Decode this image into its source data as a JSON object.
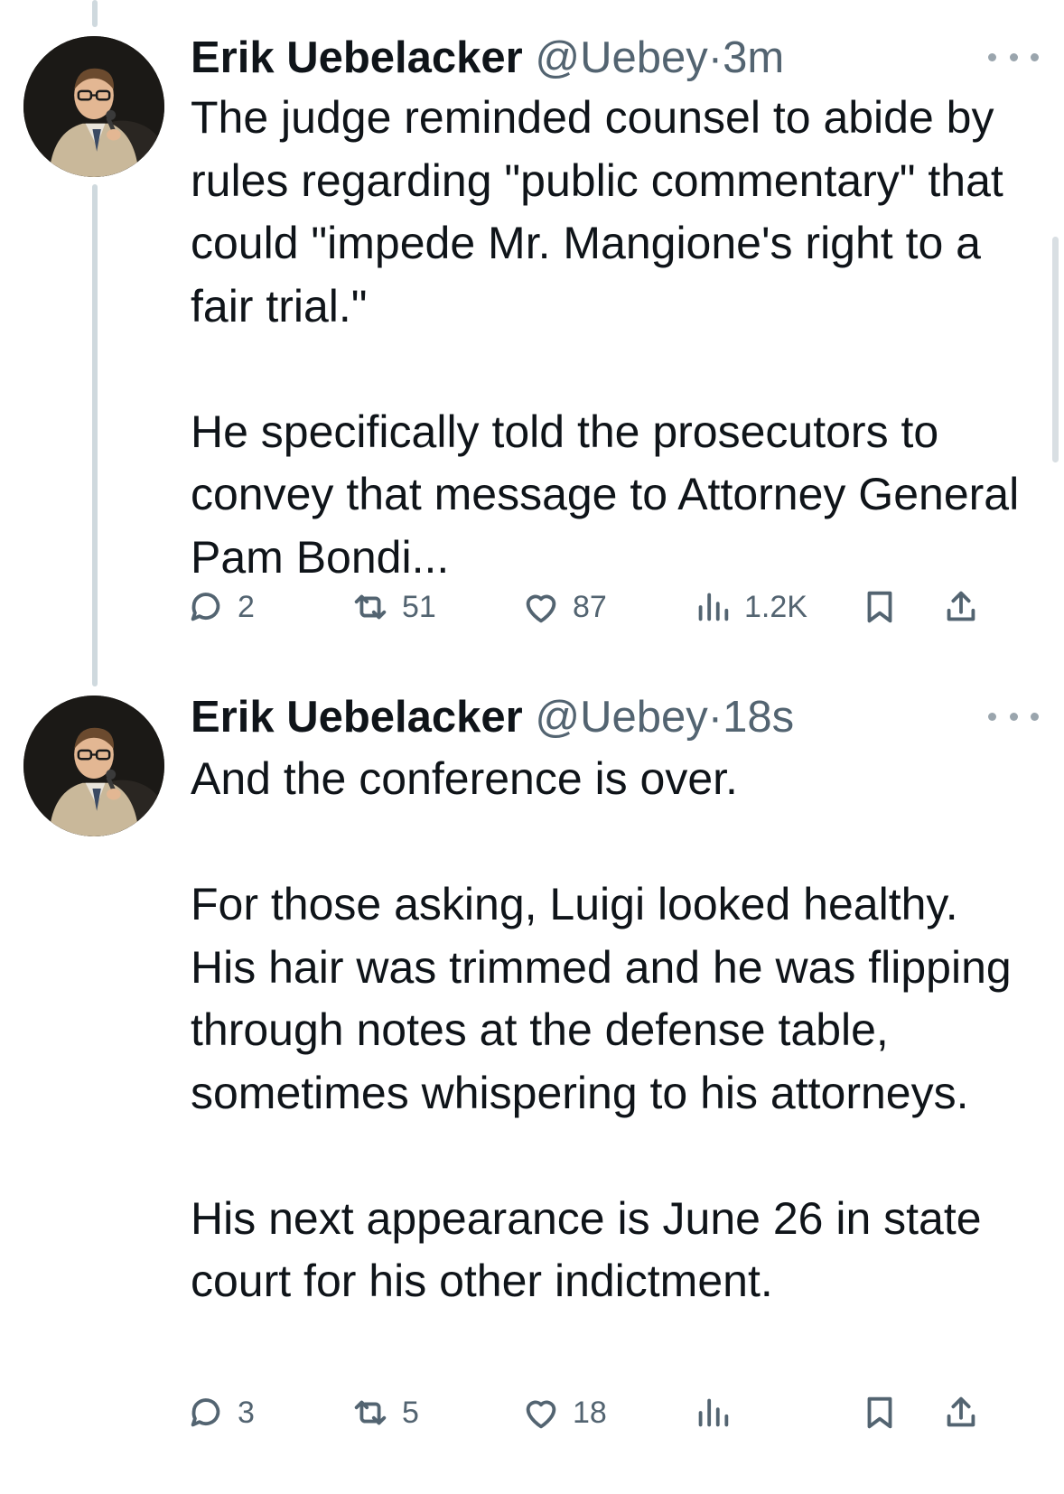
{
  "tweets": [
    {
      "author": {
        "name": "Erik Uebelacker",
        "handle": "@Uebey"
      },
      "separator": "·",
      "time": "3m",
      "paragraphs": [
        "The judge reminded counsel to abide by rules regarding \"public commentary\" that could \"impede Mr. Mangione's right to a fair trial.\"",
        "He specifically told the prosecutors to convey that message to Attorney General Pam Bondi..."
      ],
      "stats": {
        "replies": "2",
        "retweets": "51",
        "likes": "87",
        "views": "1.2K"
      }
    },
    {
      "author": {
        "name": "Erik Uebelacker",
        "handle": "@Uebey"
      },
      "separator": "·",
      "time": "18s",
      "paragraphs": [
        "And the conference is over.",
        "For those asking, Luigi looked healthy. His hair was trimmed and he was flipping through notes at the defense table, sometimes whispering to his attorneys.",
        "His next appearance is June 26 in state court for his other indictment."
      ],
      "stats": {
        "replies": "3",
        "retweets": "5",
        "likes": "18",
        "views": ""
      }
    }
  ],
  "icons": {
    "reply": "reply-icon",
    "retweet": "retweet-icon",
    "like": "heart-icon",
    "views": "views-icon",
    "bookmark": "bookmark-icon",
    "share": "share-icon",
    "more": "more-icon"
  },
  "colors": {
    "text": "#0f1419",
    "secondary": "#536471",
    "thread_line": "#cfd9de"
  }
}
